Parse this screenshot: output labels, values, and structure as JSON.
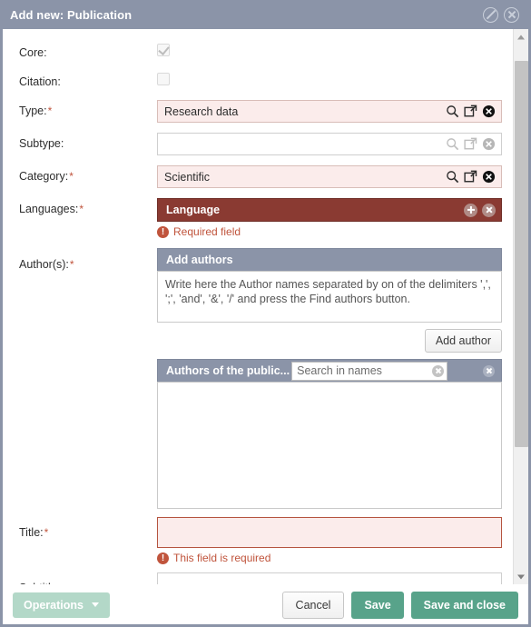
{
  "window": {
    "title": "Add new: Publication",
    "icons": [
      {
        "name": "ban-icon",
        "glyph": "ban"
      },
      {
        "name": "close-icon",
        "glyph": "close"
      }
    ],
    "titlebar_color": "#8b94a8"
  },
  "form": {
    "core": {
      "label": "Core:",
      "checked": true,
      "disabled": true
    },
    "citation": {
      "label": "Citation:",
      "checked": false,
      "disabled": true
    },
    "type": {
      "label": "Type:",
      "required": true,
      "value": "Research data",
      "invalid": true,
      "icons": [
        "search-icon",
        "open-popup-icon",
        "clear-icon"
      ]
    },
    "subtype": {
      "label": "Subtype:",
      "required": false,
      "value": "",
      "invalid": false,
      "disabled": true,
      "icons": [
        "search-icon",
        "open-popup-icon",
        "clear-icon"
      ]
    },
    "category": {
      "label": "Category:",
      "required": true,
      "value": "Scientific",
      "invalid": true,
      "icons": [
        "search-icon",
        "open-popup-icon",
        "clear-icon"
      ]
    },
    "languages": {
      "label": "Languages:",
      "required": true,
      "header_title": "Language",
      "header_color": "#8a3a32",
      "error": "Required field",
      "add_icon": "plus-circle-icon",
      "remove_icon": "close-circle-icon"
    },
    "authors": {
      "label": "Author(s):",
      "required": true,
      "add_panel_title": "Add authors",
      "add_panel_placeholder": "Write here the Author names separated by on of the delimiters ',', ';', 'and', '&', '/' and press the Find authors button.",
      "add_author_button": "Add author",
      "list_panel_title": "Authors of the public...",
      "search_placeholder": "Search in names",
      "search_value": "",
      "search_clear_icon": "clear-icon",
      "panel_clear_icon": "clear-icon",
      "list_items": []
    },
    "title": {
      "label": "Title:",
      "required": true,
      "value": "",
      "invalid": true,
      "error": "This field is required"
    },
    "subtitle": {
      "label": "Subtitle:",
      "required": false,
      "value": "",
      "invalid": false
    }
  },
  "scrollbar": {
    "up_icon": "scroll-up-arrow-icon",
    "down_icon": "scroll-down-arrow-icon"
  },
  "footer": {
    "operations_label": "Operations",
    "operations_caret": "chevron-down-icon",
    "cancel_label": "Cancel",
    "save_label": "Save",
    "save_and_close_label": "Save and close",
    "accent_green": "#58a38a",
    "operations_green": "#b3d8c8"
  },
  "symbols": {
    "asterisk": "*",
    "exclamation": "!"
  }
}
